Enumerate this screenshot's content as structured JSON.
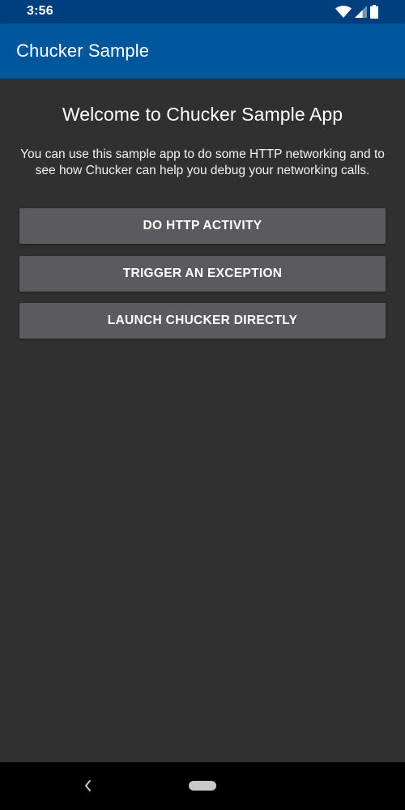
{
  "status_bar": {
    "time": "3:56",
    "icons": [
      "wifi-icon",
      "signal-icon",
      "battery-icon"
    ]
  },
  "app_bar": {
    "title": "Chucker Sample"
  },
  "main": {
    "welcome_title": "Welcome to Chucker Sample App",
    "description": "You can use this sample app to do some HTTP networking and to see how Chucker can help you debug your networking calls.",
    "buttons": [
      {
        "label": "DO HTTP ACTIVITY"
      },
      {
        "label": "TRIGGER AN EXCEPTION"
      },
      {
        "label": "LAUNCH CHUCKER DIRECTLY"
      }
    ]
  },
  "nav_bar": {
    "icons": [
      "back-icon",
      "home-pill-icon"
    ]
  },
  "colors": {
    "status_bar": "#003f7d",
    "app_bar": "#01579b",
    "background": "#303030",
    "button": "#5b5a5e",
    "nav_bar": "#000000"
  }
}
